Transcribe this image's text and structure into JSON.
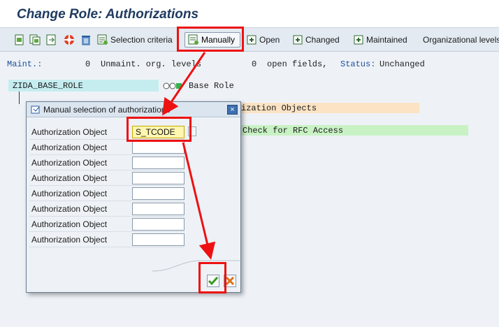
{
  "title": "Change Role: Authorizations",
  "toolbar": {
    "selection_criteria": "Selection criteria",
    "manually": "Manually",
    "open": "Open",
    "changed": "Changed",
    "maintained": "Maintained",
    "org_levels": "Organizational levels"
  },
  "status": {
    "maint_label": "Maint.:",
    "maint_count": "0",
    "unmaint_label": "Unmaint. org. levels",
    "open_count": "0",
    "open_label": "open fields,",
    "status_label": "Status:",
    "status_value": "Unchanged"
  },
  "tree": {
    "role_name": "ZIDA_BASE_ROLE",
    "role_desc": "Base Role",
    "auth_objects_fragment": "ization Objects",
    "rfc_fragment": "Check for RFC Access"
  },
  "dialog": {
    "title": "Manual selection of authorizations",
    "close": "×",
    "rows": [
      {
        "label": "Authorization Object",
        "value": "S_TCODE"
      },
      {
        "label": "Authorization Object",
        "value": ""
      },
      {
        "label": "Authorization Object",
        "value": ""
      },
      {
        "label": "Authorization Object",
        "value": ""
      },
      {
        "label": "Authorization Object",
        "value": ""
      },
      {
        "label": "Authorization Object",
        "value": ""
      },
      {
        "label": "Authorization Object",
        "value": ""
      },
      {
        "label": "Authorization Object",
        "value": ""
      }
    ]
  },
  "colors": {
    "highlight_red": "#ee1111",
    "title_blue": "#1e3a5f",
    "tree_cyan": "#c5edf0",
    "band_orange": "#fbe3c4",
    "band_green": "#c9f2c4",
    "active_field": "#fff6b0"
  },
  "icons": [
    "new-icon",
    "copy-icon",
    "generate-icon",
    "lifebuoy-icon",
    "trash-icon",
    "selection-criteria-icon",
    "manually-icon",
    "open-icon",
    "changed-icon",
    "maintained-icon",
    "dialog-icon",
    "close-icon",
    "value-help-icon",
    "ok-check-icon",
    "cancel-x-icon"
  ]
}
